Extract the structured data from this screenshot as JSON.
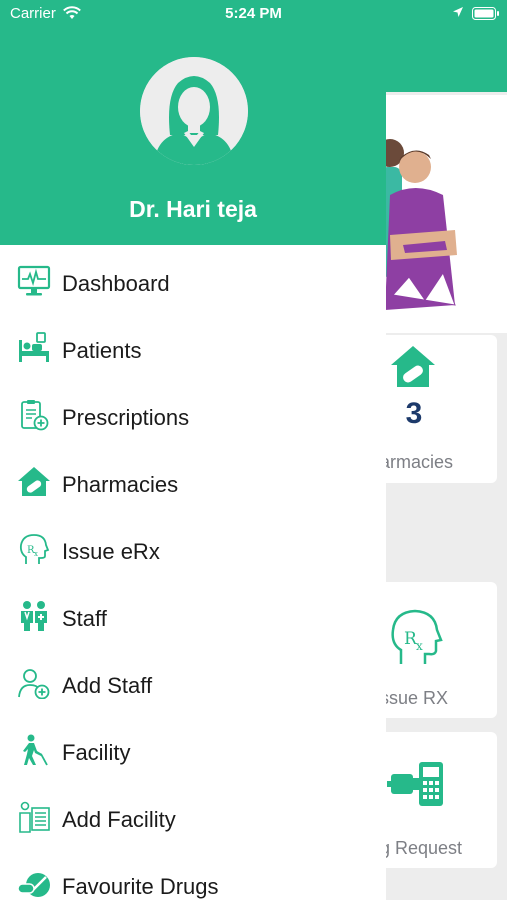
{
  "status_bar": {
    "carrier": "Carrier",
    "time": "5:24 PM"
  },
  "drawer": {
    "doctor_name": "Dr. Hari teja",
    "items": [
      {
        "label": "Dashboard",
        "icon": "monitor-icon"
      },
      {
        "label": "Patients",
        "icon": "hospital-bed-icon"
      },
      {
        "label": "Prescriptions",
        "icon": "prescription-clipboard-icon"
      },
      {
        "label": "Pharmacies",
        "icon": "pharmacy-house-icon"
      },
      {
        "label": "Issue eRx",
        "icon": "rx-head-icon"
      },
      {
        "label": "Staff",
        "icon": "staff-people-icon"
      },
      {
        "label": "Add Staff",
        "icon": "add-person-icon"
      },
      {
        "label": "Facility",
        "icon": "walking-person-icon"
      },
      {
        "label": "Add Facility",
        "icon": "facility-list-icon"
      },
      {
        "label": "Favourite Drugs",
        "icon": "pill-icon"
      }
    ]
  },
  "background": {
    "pharmacies_count": "3",
    "pharmacies_label": "armacies",
    "issue_rx_label": "ssue RX",
    "request_label": "g Request"
  },
  "colors": {
    "brand": "#26b98a",
    "count": "#1d3a6b"
  }
}
